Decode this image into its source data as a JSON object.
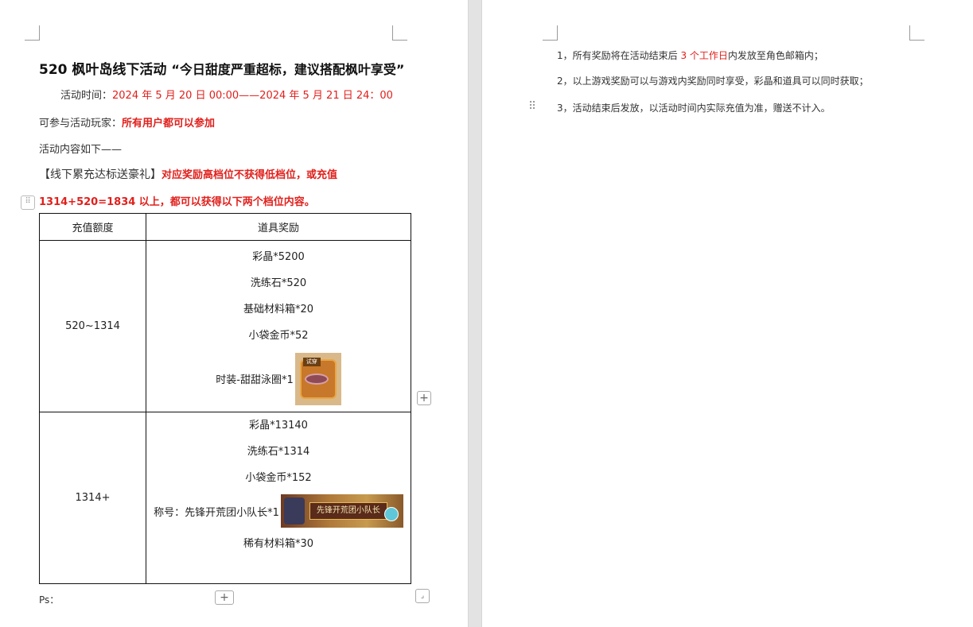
{
  "doc": {
    "title_main": "520 枫叶岛线下活动",
    "title_sub": "“今日甜度严重超标，建议搭配枫叶享受”",
    "time_label": "活动时间：",
    "time_value": "2024 年 5 月 20 日 00:00——2024 年 5 月 21 日 24：00",
    "players_label": "可参与活动玩家：",
    "players_value": "所有用户都可以参加",
    "content_intro": "活动内容如下——",
    "section_title": "【线下累充达标送豪礼】",
    "section_rule_1": "对应奖励高档位不获得低档位，或充值",
    "section_rule_2": "1314+520=1834 以上，都可以获得以下两个档位内容。",
    "ps": "Ps："
  },
  "table": {
    "headers": [
      "充值额度",
      "道具奖励"
    ],
    "rows": [
      {
        "tier": "520~1314",
        "items": [
          "彩晶*5200",
          "洗练石*520",
          "基础材料箱*20",
          "小袋金币*52",
          "时装-甜甜泳圈*1"
        ]
      },
      {
        "tier": "1314+",
        "items": [
          "彩晶*13140",
          "洗练石*1314",
          "小袋金币*152",
          "称号：先锋开荒团小队长*1",
          "稀有材料箱*30"
        ]
      }
    ],
    "fashion_icon_tag": "试穿",
    "title_icon_text": "先锋开荒团小队长"
  },
  "notes": {
    "n1_pre": "1，所有奖励将在活动结束后",
    "n1_red": "3 个工作日",
    "n1_post": "内发放至角色邮箱内；",
    "n2": "2，以上游戏奖励可以与游戏内奖励同时享受，彩晶和道具可以同时获取；",
    "n3": "3，活动结束后发放，以活动时间内实际充值为准，赠送不计入。"
  },
  "colors": {
    "accent_red": "#e0201c",
    "gutter": "#e3e3e3"
  },
  "icons": [
    "table-move-handle-icon",
    "add-row-icon",
    "add-column-icon",
    "table-resize-icon",
    "paragraph-drag-icon"
  ]
}
